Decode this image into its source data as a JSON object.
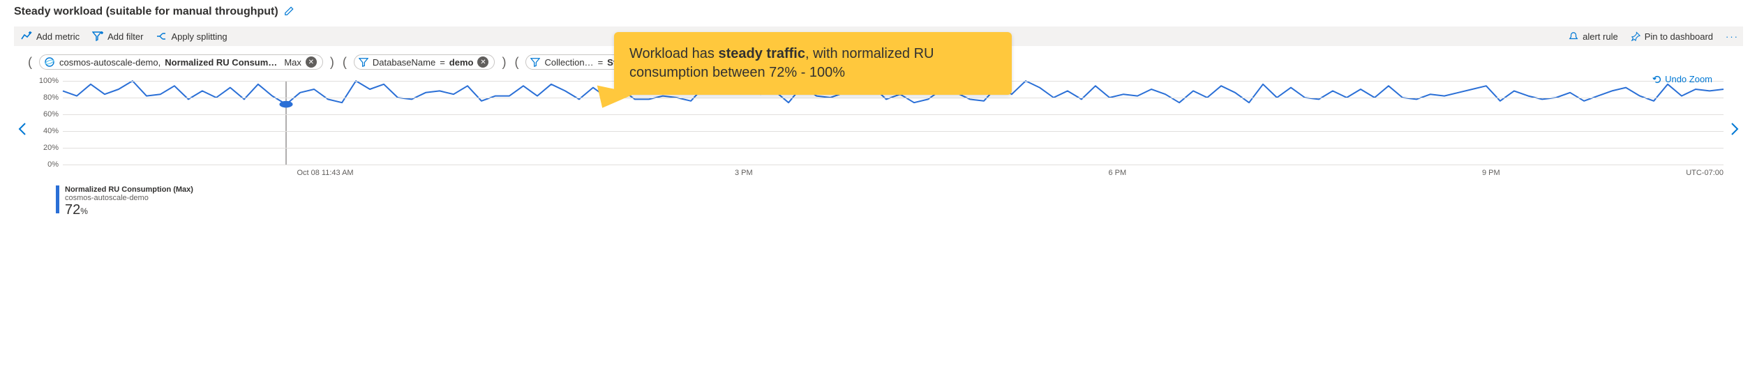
{
  "title": "Steady workload (suitable for manual throughput)",
  "toolbar": {
    "add_metric": "Add metric",
    "add_filter": "Add filter",
    "apply_splitting": "Apply splitting",
    "alert_rule": "alert rule",
    "pin_dashboard": "Pin to dashboard"
  },
  "pills": {
    "metric": {
      "resource": "cosmos-autoscale-demo,",
      "metric": "Normalized RU Consum…",
      "agg": "Max"
    },
    "filter1": {
      "key": "DatabaseName",
      "op": "=",
      "val": "demo"
    },
    "filter2": {
      "key": "Collection…",
      "op": "=",
      "val": "SteadyWo…"
    }
  },
  "undo_zoom": "Undo Zoom",
  "callout": {
    "pre": "Workload has ",
    "bold": "steady traffic",
    "post": ", with normalized RU consumption between 72% - 100%"
  },
  "legend": {
    "title": "Normalized RU Consumption (Max)",
    "sub": "cosmos-autoscale-demo",
    "value": "72",
    "unit": "%"
  },
  "x_ticks": [
    {
      "label": "Oct 08 11:43 AM",
      "pos": 15.8
    },
    {
      "label": "3 PM",
      "pos": 41
    },
    {
      "label": "6 PM",
      "pos": 63.5
    },
    {
      "label": "9 PM",
      "pos": 86
    }
  ],
  "x_tz": "UTC-07:00",
  "y_ticks": [
    "100%",
    "80%",
    "60%",
    "40%",
    "20%",
    "0%"
  ],
  "chart_data": {
    "type": "line",
    "title": "Steady workload (suitable for manual throughput)",
    "ylabel": "Normalized RU Consumption (Max) %",
    "ylim": [
      0,
      100
    ],
    "x_start": "Oct 08 11:43 AM",
    "x_timezone": "UTC-07:00",
    "cursor_index": 16,
    "cursor_value": 72,
    "series": [
      {
        "name": "Normalized RU Consumption (Max) — cosmos-autoscale-demo",
        "color": "#2a6fd6",
        "values": [
          88,
          82,
          96,
          84,
          90,
          100,
          82,
          84,
          94,
          78,
          88,
          80,
          92,
          78,
          96,
          82,
          72,
          86,
          90,
          78,
          74,
          100,
          90,
          96,
          80,
          78,
          86,
          88,
          84,
          94,
          76,
          82,
          82,
          94,
          82,
          96,
          88,
          78,
          92,
          80,
          90,
          78,
          78,
          82,
          80,
          76,
          94,
          86,
          100,
          90,
          84,
          88,
          74,
          94,
          82,
          80,
          86,
          88,
          94,
          78,
          84,
          74,
          78,
          90,
          86,
          78,
          76,
          94,
          84,
          100,
          92,
          80,
          88,
          78,
          94,
          80,
          84,
          82,
          90,
          84,
          74,
          88,
          80,
          94,
          86,
          74,
          96,
          80,
          92,
          80,
          78,
          88,
          80,
          90,
          80,
          94,
          80,
          78,
          84,
          82,
          86,
          90,
          94,
          76,
          88,
          82,
          78,
          80,
          86,
          76,
          82,
          88,
          92,
          82,
          76,
          96,
          82,
          90,
          88,
          90
        ]
      }
    ]
  }
}
